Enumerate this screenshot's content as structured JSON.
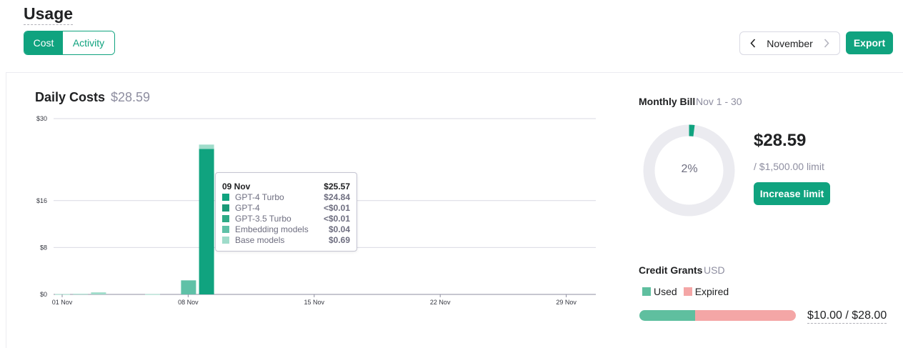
{
  "page": {
    "title": "Usage"
  },
  "tabs": {
    "cost": "Cost",
    "activity": "Activity"
  },
  "month_nav": {
    "label": "November"
  },
  "export_label": "Export",
  "colors": {
    "accent": "#10a37f",
    "gpt4_turbo": "#10a37f",
    "embedding": "#5fc1a7",
    "base_models": "#9fdcca",
    "expired": "#f4a6a6",
    "used": "#5fbf9f",
    "donut_track": "#ebebf0"
  },
  "daily": {
    "title": "Daily Costs",
    "total": "$28.59"
  },
  "chart_data": {
    "type": "bar",
    "stacked": true,
    "title": "Daily Costs",
    "y_ticks": [
      "$30",
      "$16",
      "$8",
      "$0"
    ],
    "y_tick_values": [
      30,
      16,
      8,
      0
    ],
    "x_ticks": [
      "01 Nov",
      "08 Nov",
      "15 Nov",
      "22 Nov",
      "29 Nov"
    ],
    "categories": [
      "01 Nov",
      "02 Nov",
      "03 Nov",
      "04 Nov",
      "05 Nov",
      "06 Nov",
      "07 Nov",
      "08 Nov",
      "09 Nov",
      "10 Nov",
      "11 Nov",
      "12 Nov",
      "13 Nov",
      "14 Nov",
      "15 Nov",
      "16 Nov",
      "17 Nov",
      "18 Nov",
      "19 Nov",
      "20 Nov",
      "21 Nov",
      "22 Nov",
      "23 Nov",
      "24 Nov",
      "25 Nov",
      "26 Nov",
      "27 Nov",
      "28 Nov",
      "29 Nov",
      "30 Nov"
    ],
    "series": [
      {
        "name": "GPT-4 Turbo",
        "values": [
          0,
          0,
          0,
          0,
          0,
          0,
          0,
          0,
          24.84,
          0,
          0,
          0,
          0,
          0,
          0,
          0,
          0,
          0,
          0,
          0,
          0,
          0,
          0,
          0,
          0,
          0,
          0,
          0,
          0,
          0
        ]
      },
      {
        "name": "Embedding models",
        "values": [
          0,
          0,
          0,
          0,
          0,
          0,
          0,
          2.4,
          0.04,
          0,
          0,
          0,
          0,
          0,
          0,
          0,
          0,
          0,
          0,
          0,
          0,
          0,
          0,
          0,
          0,
          0,
          0,
          0,
          0,
          0
        ]
      },
      {
        "name": "Base models",
        "values": [
          0.05,
          0.1,
          0.35,
          0,
          0,
          0.05,
          0,
          0,
          0.69,
          0,
          0,
          0,
          0,
          0,
          0,
          0,
          0,
          0,
          0,
          0,
          0,
          0,
          0,
          0,
          0,
          0,
          0,
          0,
          0,
          0
        ]
      }
    ]
  },
  "tooltip": {
    "date": "09 Nov",
    "total": "$25.57",
    "rows": [
      {
        "label": "GPT-4 Turbo",
        "value": "$24.84"
      },
      {
        "label": "GPT-4",
        "value": "<$0.01"
      },
      {
        "label": "GPT-3.5 Turbo",
        "value": "<$0.01"
      },
      {
        "label": "Embedding models",
        "value": "$0.04"
      },
      {
        "label": "Base models",
        "value": "$0.69"
      }
    ]
  },
  "bill": {
    "label": "Monthly Bill",
    "range": "Nov 1 - 30",
    "percent_text": "2%",
    "percent_value": 2,
    "amount": "$28.59",
    "limit": "/ $1,500.00 limit",
    "increase_label": "Increase limit"
  },
  "credit": {
    "label": "Credit Grants",
    "unit": "USD",
    "used_label": "Used",
    "expired_label": "Expired",
    "amount": "$10.00 / $28.00",
    "used_fraction": 0.357
  }
}
